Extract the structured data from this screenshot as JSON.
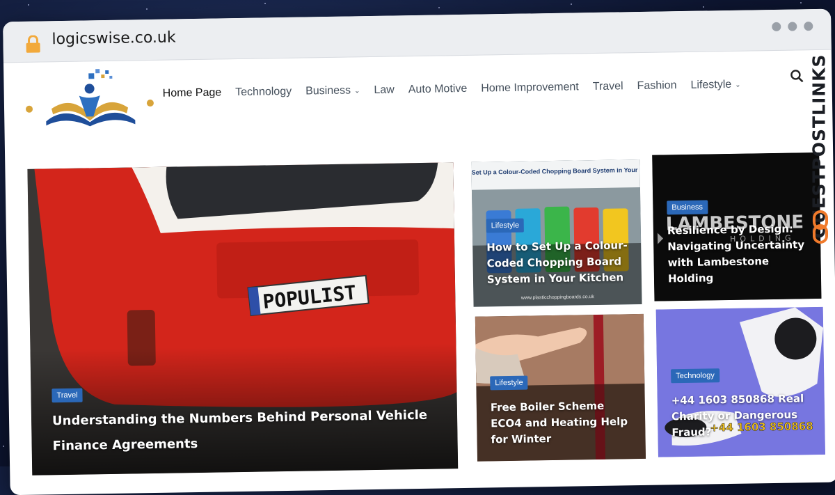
{
  "browser": {
    "url": "logicswise.co.uk"
  },
  "site": {
    "nav": [
      {
        "label": "Home Page",
        "active": true,
        "has_dropdown": false
      },
      {
        "label": "Technology",
        "active": false,
        "has_dropdown": false
      },
      {
        "label": "Business",
        "active": false,
        "has_dropdown": true
      },
      {
        "label": "Law",
        "active": false,
        "has_dropdown": false
      },
      {
        "label": "Auto Motive",
        "active": false,
        "has_dropdown": false
      },
      {
        "label": "Home Improvement",
        "active": false,
        "has_dropdown": false
      },
      {
        "label": "Travel",
        "active": false,
        "has_dropdown": false
      },
      {
        "label": "Fashion",
        "active": false,
        "has_dropdown": false
      },
      {
        "label": "Lifestyle",
        "active": false,
        "has_dropdown": true
      }
    ],
    "search_icon": "search-icon"
  },
  "posts": {
    "featured": {
      "category": "Travel",
      "title": "Understanding the Numbers Behind Personal Vehicle Finance Agreements",
      "plate_text": "POPULIST"
    },
    "grid": [
      {
        "category": "Lifestyle",
        "title": "How to Set Up a Colour-Coded Chopping Board System in Your Kitchen",
        "image_caption": "How to Set Up a Colour-Coded Chopping Board System in Your Kitchen",
        "image_footer": "www.plasticchoppingboards.co.uk"
      },
      {
        "category": "Business",
        "title": "Resilience by Design: Navigating Uncertainty with Lambestone Holding",
        "image_text": "LAMBESTONE",
        "image_subtext": "HOLDING"
      },
      {
        "category": "Lifestyle",
        "title": "Free Boiler Scheme ECO4 and Heating Help for Winter"
      },
      {
        "category": "Technology",
        "title": "+44 1603 850868 Real Charity or Dangerous Fraud?",
        "image_text": "+44 1603 850868"
      }
    ]
  },
  "watermark": {
    "text": "GUESTPOSTLINKS"
  },
  "colors": {
    "badge": "#2b68b8",
    "accent_orange": "#f07a2b",
    "lock": "#f2a93b"
  }
}
